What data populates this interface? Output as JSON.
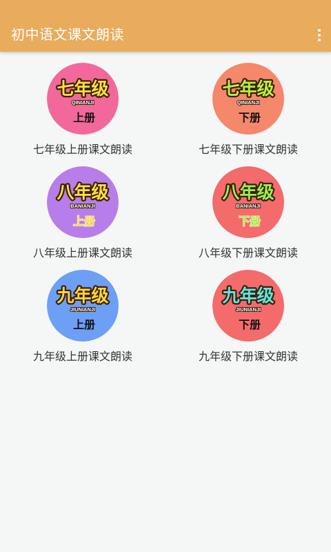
{
  "app": {
    "title": "初中语文课文朗读",
    "menu_icon": "more-vert-icon",
    "bar_color": "#e9ab5c"
  },
  "books": [
    {
      "label": "七年级上册课文朗读",
      "badge": {
        "grade": "七年级",
        "pinyin": "QINIANJI",
        "volume": "上册",
        "bg_color": "#f2689a",
        "grade_color": "#ffe13a",
        "volume_color": "#111111"
      }
    },
    {
      "label": "七年级下册课文朗读",
      "badge": {
        "grade": "七年级",
        "pinyin": "QINIANJI",
        "volume": "下册",
        "bg_color": "#f5876b",
        "grade_color": "#b9f23a",
        "volume_color": "#111111"
      }
    },
    {
      "label": "八年级上册课文朗读",
      "badge": {
        "grade": "八年级",
        "pinyin": "BANIANJI",
        "volume": "上册",
        "bg_color": "#b77ee9",
        "grade_color": "#ffe13a",
        "volume_color": "#ffd83a"
      }
    },
    {
      "label": "八年级下册课文朗读",
      "badge": {
        "grade": "八年级",
        "pinyin": "BANIANJI",
        "volume": "下册",
        "bg_color": "#f46b6b",
        "grade_color": "#9bf24a",
        "volume_color": "#a6f03a"
      }
    },
    {
      "label": "九年级上册课文朗读",
      "badge": {
        "grade": "九年级",
        "pinyin": "JIUNIANJI",
        "volume": "上册",
        "bg_color": "#6d9ff5",
        "grade_color": "#ffd83a",
        "volume_color": "#111111"
      }
    },
    {
      "label": "九年级下册课文朗读",
      "badge": {
        "grade": "九年级",
        "pinyin": "JIUNIANJI",
        "volume": "下册",
        "bg_color": "#f46b6b",
        "grade_color": "#5fe8e0",
        "volume_color": "#111111"
      }
    }
  ]
}
